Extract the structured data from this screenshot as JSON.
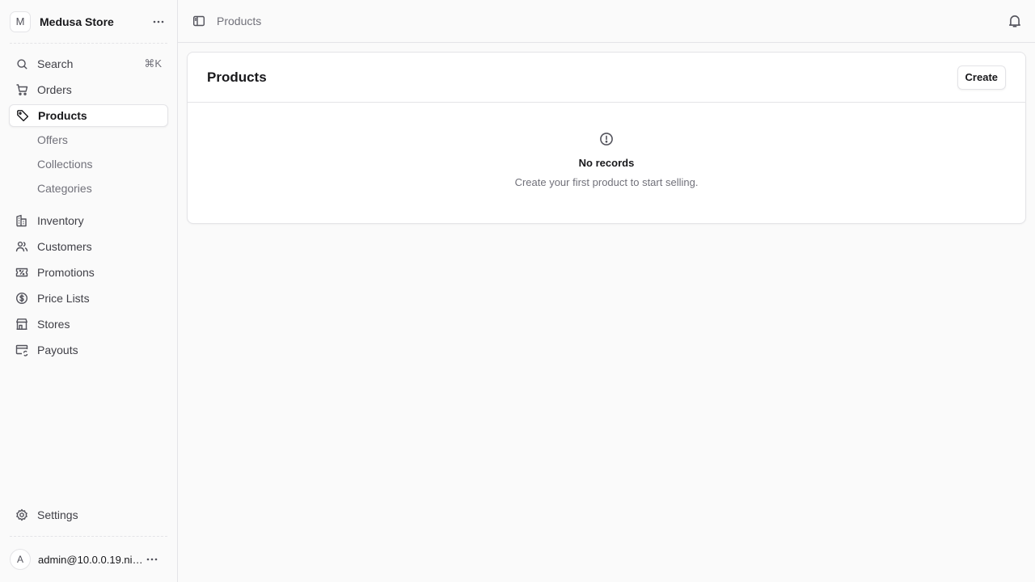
{
  "store": {
    "avatar_letter": "M",
    "name": "Medusa Store"
  },
  "nav": {
    "search": {
      "label": "Search",
      "shortcut": "⌘K"
    },
    "orders": "Orders",
    "products": "Products",
    "products_sub": [
      "Offers",
      "Collections",
      "Categories"
    ],
    "inventory": "Inventory",
    "customers": "Customers",
    "promotions": "Promotions",
    "price_lists": "Price Lists",
    "stores": "Stores",
    "payouts": "Payouts",
    "settings": "Settings"
  },
  "user": {
    "avatar_letter": "A",
    "email": "admin@10.0.0.19.nip..."
  },
  "topbar": {
    "breadcrumb": "Products"
  },
  "main": {
    "title": "Products",
    "create_label": "Create",
    "empty_title": "No records",
    "empty_subtitle": "Create your first product to start selling."
  }
}
